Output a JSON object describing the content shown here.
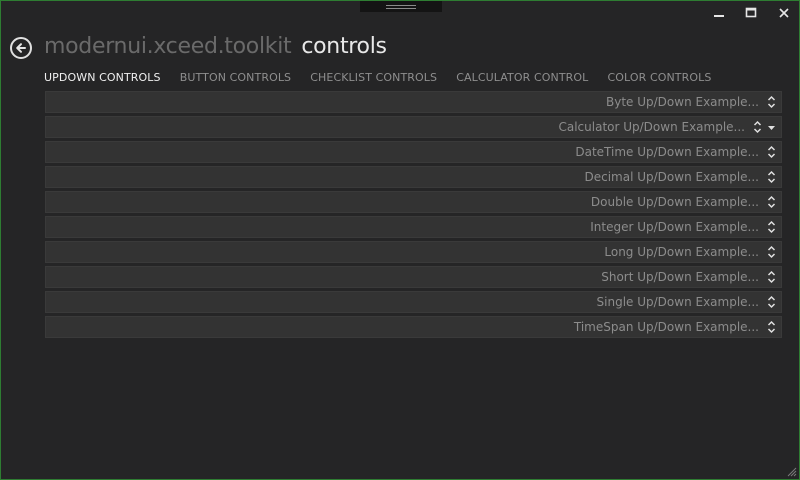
{
  "window": {
    "minimize_glyph": "🗕",
    "maximize_glyph": "☐",
    "close_glyph": "✕"
  },
  "header": {
    "app_title": "modernui.xceed.toolkit",
    "page_title": "controls"
  },
  "tabs": [
    {
      "label": "UPDOWN CONTROLS",
      "active": true
    },
    {
      "label": "BUTTON CONTROLS",
      "active": false
    },
    {
      "label": "CHECKLIST CONTROLS",
      "active": false
    },
    {
      "label": "CALCULATOR CONTROL",
      "active": false
    },
    {
      "label": "COLOR CONTROLS",
      "active": false
    }
  ],
  "updowns": [
    {
      "placeholder": "Byte Up/Down Example..."
    },
    {
      "placeholder": "Calculator Up/Down Example...",
      "has_dropdown": true
    },
    {
      "placeholder": "DateTime Up/Down Example..."
    },
    {
      "placeholder": "Decimal Up/Down Example..."
    },
    {
      "placeholder": "Double Up/Down Example..."
    },
    {
      "placeholder": "Integer Up/Down Example..."
    },
    {
      "placeholder": "Long Up/Down Example..."
    },
    {
      "placeholder": "Short Up/Down Example..."
    },
    {
      "placeholder": "Single Up/Down Example..."
    },
    {
      "placeholder": "TimeSpan Up/Down Example..."
    }
  ],
  "colors": {
    "accent_border": "#2e7d32",
    "background": "#252526",
    "field": "#333333"
  },
  "icons": {
    "back": "arrow-left-circle-icon",
    "spinner": "up-down-chevrons-icon",
    "dropdown": "chevron-down-icon",
    "resize": "resize-grip-icon"
  }
}
